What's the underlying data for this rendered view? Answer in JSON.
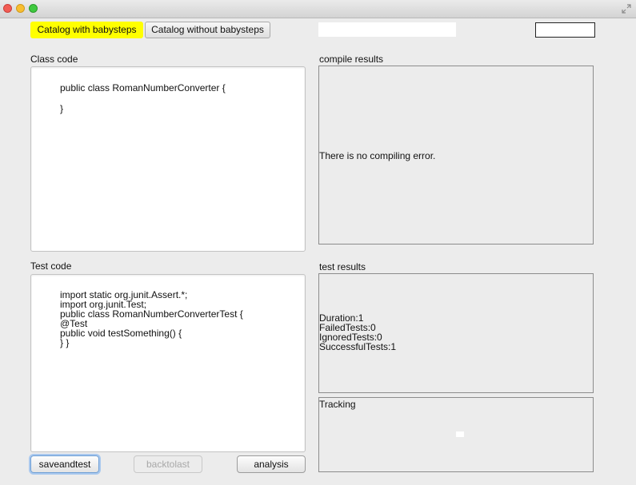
{
  "tabs": [
    {
      "label": "Catalog with babysteps",
      "active": true
    },
    {
      "label": "Catalog without babysteps",
      "active": false
    }
  ],
  "class_code": {
    "label": "Class code",
    "lines": [
      "public class RomanNumberConverter {",
      "",
      "}"
    ]
  },
  "test_code": {
    "label": "Test code",
    "lines": [
      "import static org.junit.Assert.*;",
      "import org.junit.Test;",
      "public class RomanNumberConverterTest {",
      "@Test",
      "public void testSomething() {",
      "} }"
    ]
  },
  "compile_results": {
    "label": "compile results",
    "text": "There is no compiling error."
  },
  "test_results": {
    "label": "test results",
    "lines": [
      "Duration:1",
      "FailedTests:0",
      "IgnoredTests:0",
      "SuccessfulTests:1"
    ]
  },
  "tracking": {
    "label": "Tracking"
  },
  "buttons": {
    "saveandtest": "saveandtest",
    "backtolast": "backtolast",
    "analysis": "analysis"
  },
  "colors": {
    "active_tab": "#ffff00",
    "window_bg": "#ececec"
  }
}
